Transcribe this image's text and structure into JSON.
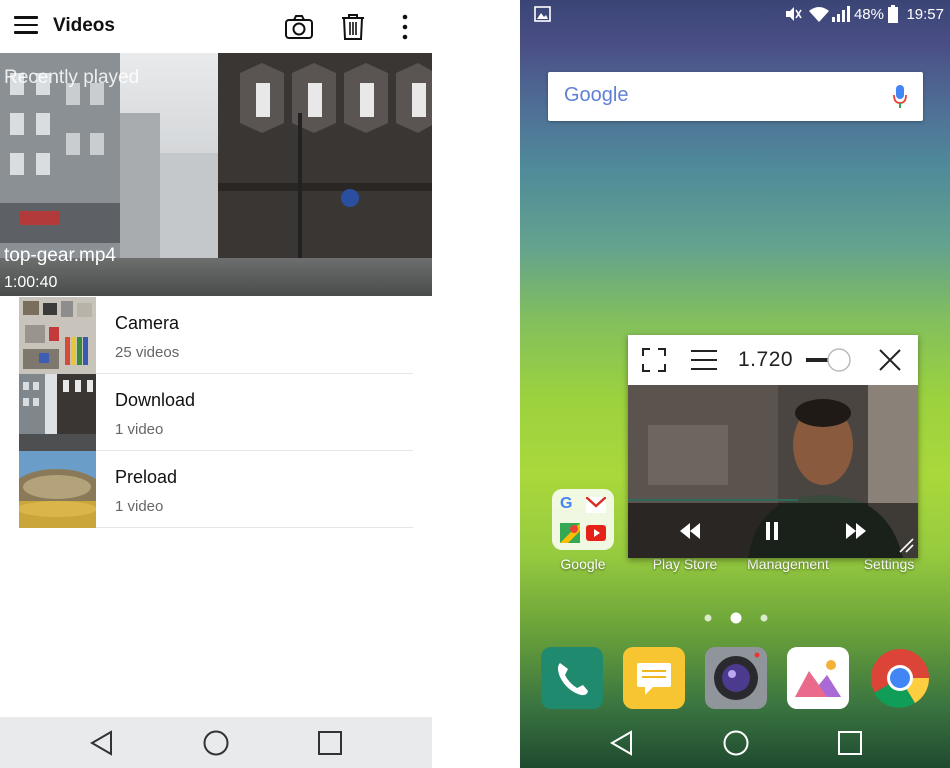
{
  "left": {
    "title": "Videos",
    "recent": {
      "label": "Recently played",
      "file_name": "top-gear.mp4",
      "duration": "1:00:40"
    },
    "folders": [
      {
        "name": "Camera",
        "count": "25 videos"
      },
      {
        "name": "Download",
        "count": "1 video"
      },
      {
        "name": "Preload",
        "count": "1 video"
      }
    ]
  },
  "right": {
    "status": {
      "battery": "48%",
      "time": "19:57"
    },
    "search": {
      "logo": "Google"
    },
    "popup": {
      "rate": "1.720"
    },
    "apps": [
      {
        "label": "Google"
      },
      {
        "label": "Play Store"
      },
      {
        "label": "Management"
      },
      {
        "label": "Settings"
      }
    ]
  }
}
